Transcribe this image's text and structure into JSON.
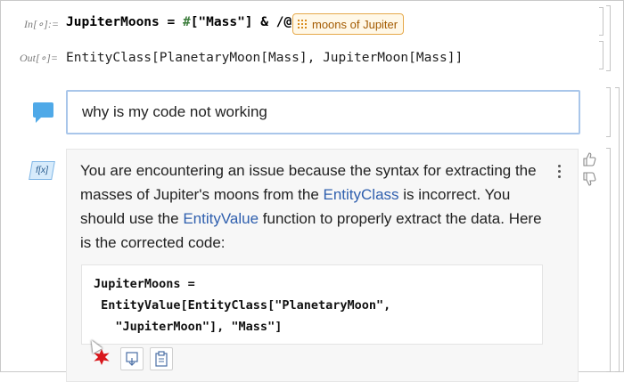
{
  "input_cell": {
    "label": "In[∘]:=",
    "code_head": "JupiterMoons = ",
    "code_hash": "#",
    "code_rest": "[\"Mass\"] & /@",
    "entity_chip": "moons of Jupiter"
  },
  "output_cell": {
    "label": "Out[∘]=",
    "code": "EntityClass[PlanetaryMoon[Mass], JupiterMoon[Mass]]"
  },
  "prompt": {
    "text": "why is my code not working"
  },
  "response": {
    "fx_label": "f[x]",
    "p1": "You are encountering an issue because the syntax for extracting the masses of Jupiter's moons from the ",
    "p1_link": "EntityClass",
    "p1_end": " is incorrect. You should use the ",
    "p2_link": "EntityValue",
    "p2_end": " function to properly extract the data. Here is the corrected code:",
    "code_line1": "JupiterMoons =",
    "code_line2": " EntityValue[EntityClass[\"PlanetaryMoon\",",
    "code_line3": "   \"JupiterMoon\"], \"Mass\"]"
  },
  "colors": {
    "accent": "#4fa9e8",
    "link": "#2f5fae",
    "chip_border": "#e6a94a",
    "chip_text": "#a35a00"
  }
}
